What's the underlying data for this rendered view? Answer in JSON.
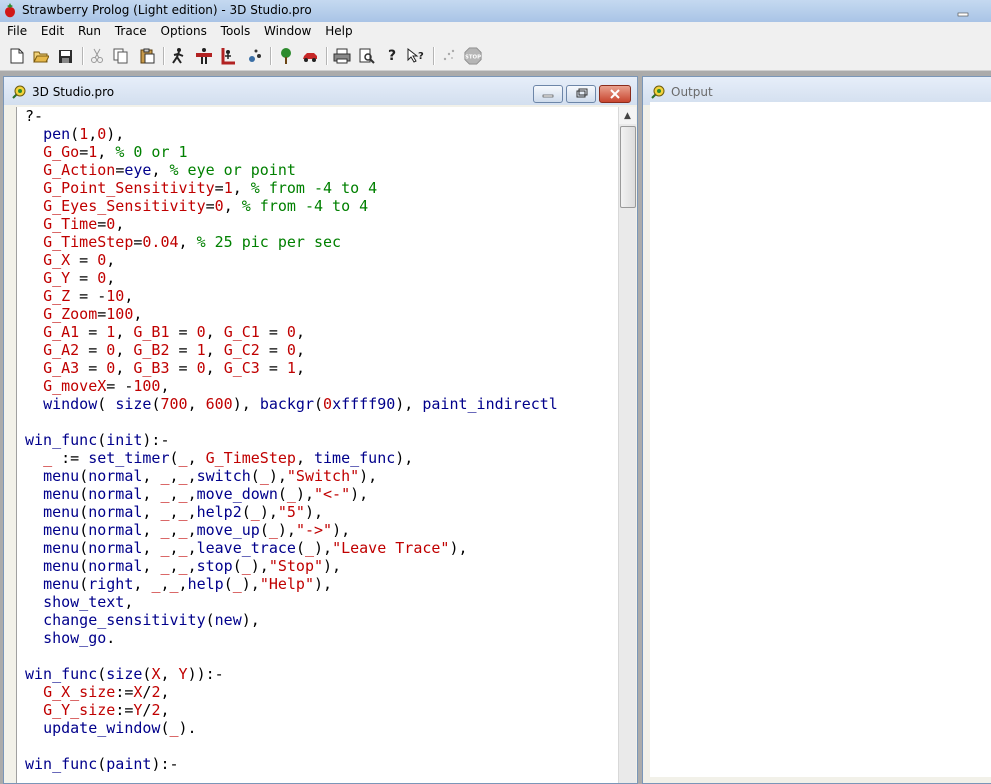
{
  "window": {
    "title": "Strawberry Prolog (Light edition) - 3D Studio.pro"
  },
  "menu": [
    "File",
    "Edit",
    "Run",
    "Trace",
    "Options",
    "Tools",
    "Window",
    "Help"
  ],
  "toolbar_icons": [
    "new-file-icon",
    "open-folder-icon",
    "save-icon",
    "cut-icon",
    "copy-icon",
    "paste-icon",
    "run-icon",
    "step-icon",
    "trace-icon",
    "watch-icon",
    "tree-icon",
    "car-icon",
    "print-icon",
    "print-preview-icon",
    "help-icon",
    "context-help-icon",
    "sparkle-icon",
    "stop-icon"
  ],
  "editor_window": {
    "title": "3D Studio.pro"
  },
  "output_window": {
    "title": "Output"
  },
  "code_lines": [
    "?-",
    "  pen(1,0),",
    "  G_Go=1, % 0 or 1",
    "  G_Action=eye, % eye or point",
    "  G_Point_Sensitivity=1, % from -4 to 4",
    "  G_Eyes_Sensitivity=0, % from -4 to 4",
    "  G_Time=0,",
    "  G_TimeStep=0.04, % 25 pic per sec",
    "  G_X = 0,",
    "  G_Y = 0,",
    "  G_Z = -10,",
    "  G_Zoom=100,",
    "  G_A1 = 1, G_B1 = 0, G_C1 = 0,",
    "  G_A2 = 0, G_B2 = 1, G_C2 = 0,",
    "  G_A3 = 0, G_B3 = 0, G_C3 = 1,",
    "  G_moveX= -100,",
    "  window( size(700, 600), backgr(0xffff90), paint_indirectl",
    "",
    "win_func(init):-",
    "  _ := set_timer(_, G_TimeStep, time_func),",
    "  menu(normal, _,_,switch(_),\"Switch\"),",
    "  menu(normal, _,_,move_down(_),\"<-\"),",
    "  menu(normal, _,_,help2(_),\"5\"),",
    "  menu(normal, _,_,move_up(_),\"->\"),",
    "  menu(normal, _,_,leave_trace(_),\"Leave Trace\"),",
    "  menu(normal, _,_,stop(_),\"Stop\"),",
    "  menu(right, _,_,help(_),\"Help\"),",
    "  show_text,",
    "  change_sensitivity(new),",
    "  show_go.",
    "",
    "win_func(size(X, Y)):-",
    "  G_X_size:=X/2,",
    "  G_Y_size:=Y/2,",
    "  update_window(_).",
    "",
    "win_func(paint):-"
  ],
  "colors": {
    "keyword": "#00008b",
    "variable": "#c00000",
    "comment": "#008000",
    "string": "#c00000"
  }
}
